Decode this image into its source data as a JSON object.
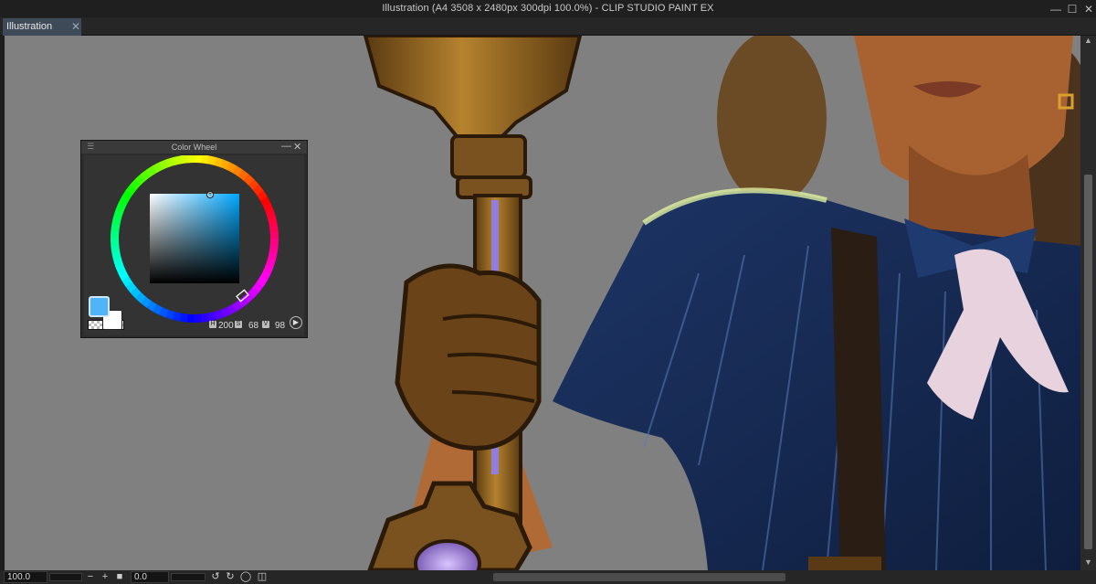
{
  "window": {
    "title": "Illustration (A4 3508 x 2480px 300dpi 100.0%)  - CLIP STUDIO PAINT EX",
    "minimize_icon": "minimize-icon",
    "maximize_icon": "maximize-icon",
    "close_icon": "close-icon"
  },
  "tabs": [
    {
      "label": "Illustration",
      "active": true
    }
  ],
  "color_wheel": {
    "title": "Color Wheel",
    "main_color": "#4fb5f7",
    "sub_color": "#ffffff",
    "hue": 200,
    "saturation": 68,
    "value": 98,
    "hue_value": "200",
    "saturation_value": "68",
    "value_value": "98",
    "hue_icon_label": "H",
    "saturation_icon_label": "S",
    "value_icon_label": "V"
  },
  "statusbar": {
    "zoom": "100.0",
    "rotation": "0.0"
  },
  "colors": {
    "canvas_bg": "#808080",
    "ui_dark": "#1f1f1f",
    "tab_active": "#3f4a58"
  }
}
